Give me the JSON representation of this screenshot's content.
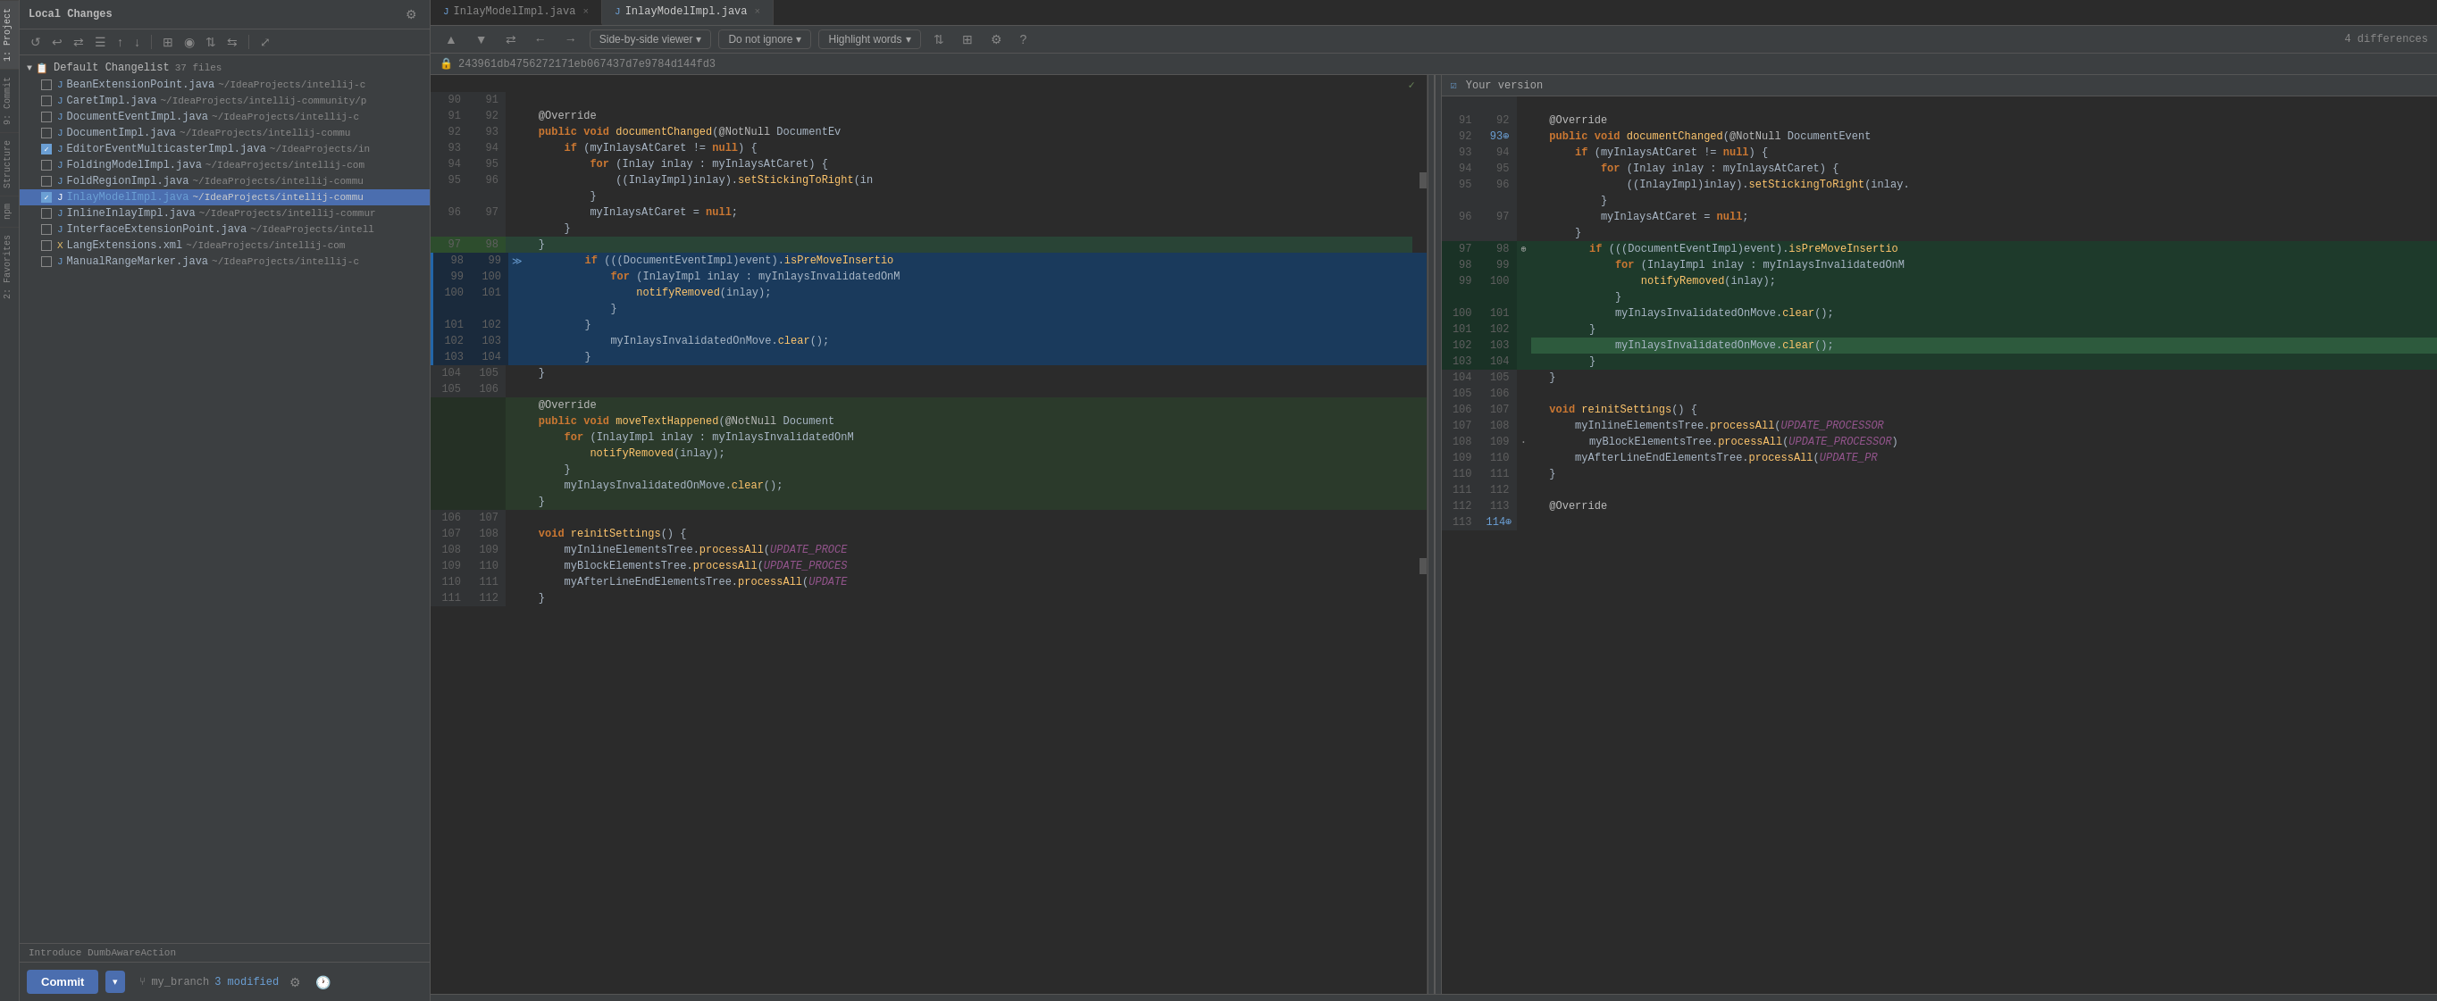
{
  "leftPanel": {
    "title": "Local Changes",
    "changelistHeader": "Default Changelist",
    "fileCount": "37 files",
    "files": [
      {
        "name": "BeanExtensionPoint.java",
        "path": "~/IdeaProjects/intellij-c",
        "checked": false,
        "modified": false
      },
      {
        "name": "CaretImpl.java",
        "path": "~/IdeaProjects/intellij-community/p",
        "checked": false,
        "modified": false
      },
      {
        "name": "DocumentEventImpl.java",
        "path": "~/IdeaProjects/intellij-c",
        "checked": false,
        "modified": false
      },
      {
        "name": "DocumentImpl.java",
        "path": "~/IdeaProjects/intellij-commu",
        "checked": false,
        "modified": false
      },
      {
        "name": "EditorEventMulticasterImpl.java",
        "path": "~/IdeaProjects/in",
        "checked": true,
        "modified": false
      },
      {
        "name": "FoldingModelImpl.java",
        "path": "~/IdeaProjects/intellij-com",
        "checked": false,
        "modified": false
      },
      {
        "name": "FoldRegionImpl.java",
        "path": "~/IdeaProjects/intellij-commu",
        "checked": false,
        "modified": false
      },
      {
        "name": "InlayModelImpl.java",
        "path": "~/IdeaProjects/intellij-commu",
        "checked": true,
        "modified": true,
        "selected": true
      },
      {
        "name": "InlineInlayImpl.java",
        "path": "~/IdeaProjects/intellij-commur",
        "checked": false,
        "modified": false
      },
      {
        "name": "InterfaceExtensionPoint.java",
        "path": "~/IdeaProjects/intell",
        "checked": false,
        "modified": false
      },
      {
        "name": "LangExtensions.xml",
        "path": "~/IdeaProjects/intellij-com",
        "checked": false,
        "modified": false
      },
      {
        "name": "ManualRangeMarker.java",
        "path": "~/IdeaProjects/intellij-c",
        "checked": false,
        "modified": false
      }
    ],
    "statusText": "Introduce DumbAwareAction",
    "bottomBar": {
      "commitLabel": "Commit",
      "branchName": "my_branch",
      "modifiedCount": "3 modified"
    }
  },
  "diffViewer": {
    "tabs": [
      {
        "label": "InlayModelImpl.java",
        "icon": "java",
        "active": false,
        "closable": true
      },
      {
        "label": "InlayModelImpl.java",
        "icon": "java",
        "active": true,
        "closable": true
      }
    ],
    "toolbar": {
      "navPrev": "▲",
      "navNext": "▼",
      "viewMode": "Side-by-side viewer",
      "ignoreMode": "Do not ignore",
      "highlightMode": "Highlight words",
      "differencesCount": "4 differences"
    },
    "commitHash": "243961db4756272171eb067437d7e9784d144fd3",
    "yourVersionLabel": "Your version",
    "leftPane": {
      "lines": [
        {
          "left": "90",
          "right": "91",
          "content": "",
          "type": "normal"
        },
        {
          "left": "91",
          "right": "92",
          "content": "    @Override",
          "type": "normal",
          "hasMarker": false
        },
        {
          "left": "92",
          "right": "93",
          "content": "    public void documentChanged(@NotNull DocumentEv",
          "type": "normal"
        },
        {
          "left": "93",
          "right": "94",
          "content": "        if (myInlaysAtCaret != null) {",
          "type": "normal"
        },
        {
          "left": "94",
          "right": "95",
          "content": "            for (Inlay inlay : myInlaysAtCaret) {",
          "type": "normal"
        },
        {
          "left": "95",
          "right": "96",
          "content": "                ((InlayImpl)inlay).setStickingToRight(in",
          "type": "normal"
        },
        {
          "left": "",
          "right": "",
          "content": "            }",
          "type": "normal"
        },
        {
          "left": "96",
          "right": "97",
          "content": "            myInlaysAtCaret = null;",
          "type": "normal"
        },
        {
          "left": "",
          "right": "",
          "content": "        }",
          "type": "normal"
        },
        {
          "left": "97",
          "right": "98",
          "content": "    }",
          "type": "changed"
        },
        {
          "left": "98",
          "right": "99",
          "content": "        if (((DocumentEventImpl)event).isPreMoveInsertio",
          "type": "changed",
          "arrow": true
        },
        {
          "left": "99",
          "right": "100",
          "content": "            for (InlayImpl inlay : myInlaysInvalidatedOnM",
          "type": "normal"
        },
        {
          "left": "100",
          "right": "101",
          "content": "                notifyRemoved(inlay);",
          "type": "normal"
        },
        {
          "left": "",
          "right": "",
          "content": "            }",
          "type": "normal"
        },
        {
          "left": "101",
          "right": "102",
          "content": "        }",
          "type": "normal"
        },
        {
          "left": "102",
          "right": "103",
          "content": "            myInlaysInvalidatedOnMove.clear();",
          "type": "normal"
        },
        {
          "left": "103",
          "right": "104",
          "content": "        }",
          "type": "normal"
        },
        {
          "left": "104",
          "right": "105",
          "content": "    }",
          "type": "normal"
        },
        {
          "left": "105",
          "right": "106",
          "content": "",
          "type": "normal"
        },
        {
          "left": "106",
          "right": "107",
          "content": "    void reinitSettings() {",
          "type": "normal"
        },
        {
          "left": "107",
          "right": "108",
          "content": "        myInlineElementsTree.processAll(UPDATE_PROCESSOR",
          "type": "normal"
        },
        {
          "left": "108",
          "right": "109",
          "content": "        myBlockElementsTree.processAll(UPDATE_PROCESSOR)",
          "type": "normal"
        },
        {
          "left": "109",
          "right": "110",
          "content": "        myAfterLineEndElementsTree.processAll(UPDATE_PR",
          "type": "normal"
        },
        {
          "left": "110",
          "right": "111",
          "content": "    }",
          "type": "normal"
        },
        {
          "left": "111",
          "right": "112",
          "content": "",
          "type": "normal"
        },
        {
          "left": "112",
          "right": "113",
          "content": "    @Override",
          "type": "normal"
        },
        {
          "left": "113",
          "right": "114",
          "content": "",
          "type": "normal"
        }
      ]
    }
  },
  "icons": {
    "settings": "⚙",
    "gear": "⚙",
    "refresh": "↺",
    "undo": "↩",
    "redo": "↪",
    "expand": "⤢",
    "upload": "↑",
    "download": "↓",
    "check": "✓",
    "arrow_left": "←",
    "arrow_right": "→",
    "arrow_up": "↑",
    "arrow_down": "↓",
    "branch": "",
    "close": "×",
    "lock": "🔒",
    "question": "?",
    "columns": "⊞",
    "filter": "⇅",
    "diff_arrow": "≫",
    "chevron_down": "▾",
    "triangle_right": "▶",
    "triangle_down": "▼"
  }
}
